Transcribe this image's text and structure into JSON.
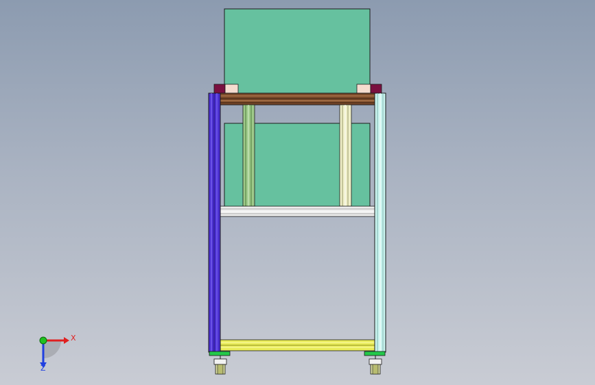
{
  "viewport": {
    "background_top": "#8c9bb0",
    "background_bottom": "#c9ccd4"
  },
  "model": {
    "panel_color": "#66c19f",
    "frame_outline": "#1a1a1a",
    "left_post_color": "#4a2fcf",
    "right_post_color": "#c9f3ee",
    "top_beam_color": "#7a4a2a",
    "mid_beam_color": "#eeeeee",
    "bottom_beam_color": "#e9ec5a",
    "inner_post_left_color": "#9ec98a",
    "inner_post_right_color": "#efefc8",
    "bracket_dark_color": "#7a1040",
    "bracket_light_color": "#f5dccf",
    "foot_color": "#23c84a",
    "caster_color": "#d8dca0"
  },
  "triad": {
    "x_label": "X",
    "z_label": "Z",
    "x_color": "#e02020",
    "y_color": "#20c020",
    "z_color": "#2040e0"
  }
}
